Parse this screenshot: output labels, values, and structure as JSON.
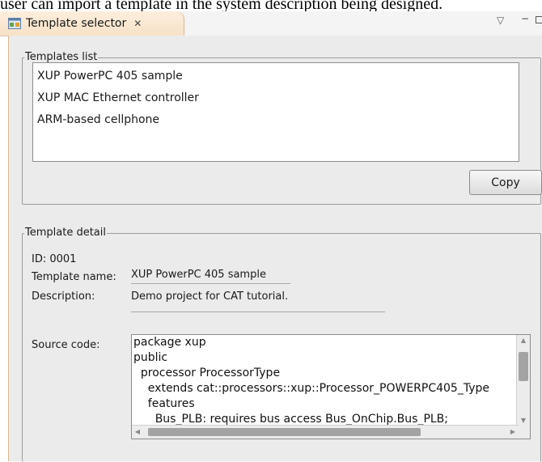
{
  "caption": "user can import a template in the system description being designed.",
  "tab": {
    "title": "Template selector",
    "close_glyph": "✕",
    "icon": "template-view-icon",
    "menu_glyph": "▽",
    "minimize_glyph": "−"
  },
  "templates_group": {
    "title": "Templates list",
    "items": [
      "XUP PowerPC 405 sample",
      "XUP MAC Ethernet controller",
      "ARM-based cellphone"
    ],
    "copy_label": "Copy"
  },
  "detail_group": {
    "title": "Template detail",
    "id_text": "ID: 0001",
    "name_label": "Template name:",
    "name_value": "XUP PowerPC 405 sample",
    "description_label": "Description:",
    "description_value": "Demo project for CAT tutorial.",
    "source_label": "Source code:",
    "source_lines": [
      "package xup",
      "public",
      "  processor ProcessorType",
      "    extends cat::processors::xup::Processor_POWERPC405_Type",
      "    features",
      "      Bus_PLB: requires bus access Bus_OnChip.Bus_PLB;"
    ]
  },
  "colors": {
    "tab_background": "#f7e2c8",
    "panel_background": "#ebebeb",
    "tab_border": "#d8b68d"
  }
}
